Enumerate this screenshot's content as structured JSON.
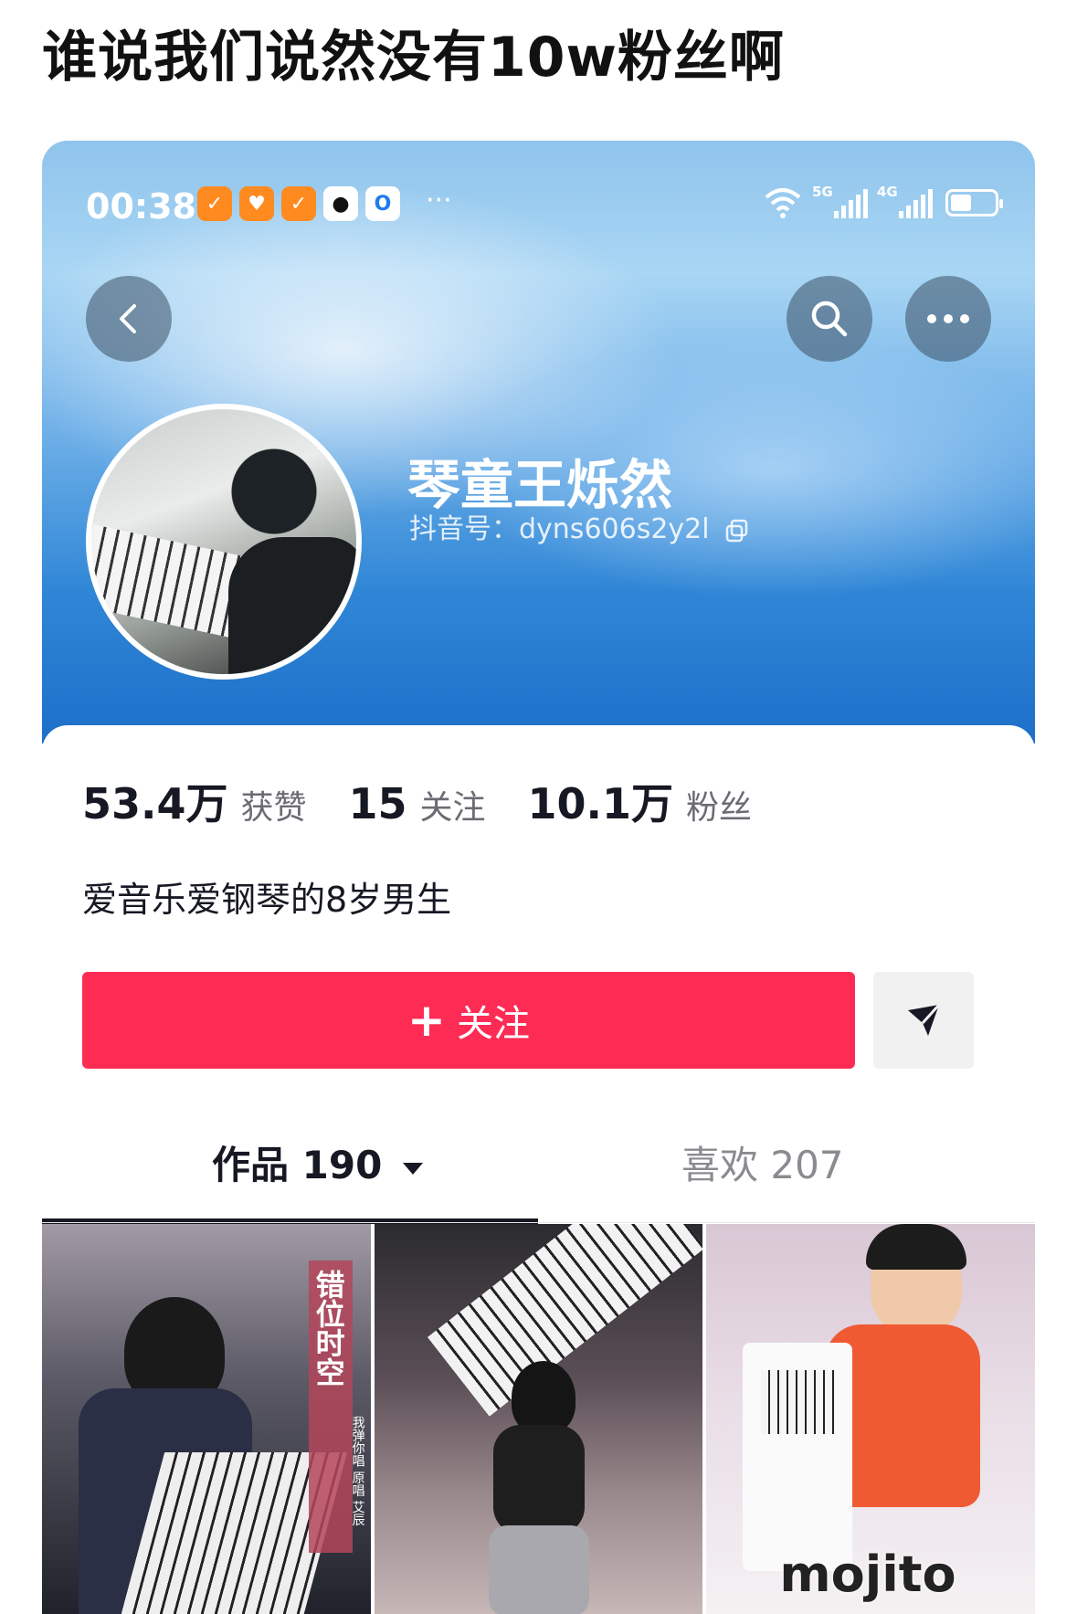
{
  "post": {
    "title": "谁说我们说然没有10w粉丝啊"
  },
  "status_bar": {
    "time": "00:38",
    "more": "···",
    "signal_5g": "5G",
    "signal_4g": "4G"
  },
  "profile": {
    "nickname": "琴童王烁然",
    "douyin_id": "抖音号：dyns606s2y2l",
    "bio": "爱音乐爱钢琴的8岁男生"
  },
  "stats": [
    {
      "value": "53.4万",
      "label": "获赞"
    },
    {
      "value": "15",
      "label": "关注"
    },
    {
      "value": "10.1万",
      "label": "粉丝"
    }
  ],
  "actions": {
    "follow_plus": "+",
    "follow_label": "关注"
  },
  "tabs": [
    {
      "label": "作品 190",
      "active": true
    },
    {
      "label": "喜欢 207",
      "active": false
    }
  ],
  "videos": [
    {
      "cover_title": "错位时空",
      "cover_sub": "我弹你唱 原唱 艾辰"
    },
    {
      "cover_title": ""
    },
    {
      "cover_title": "mojito"
    }
  ],
  "colors": {
    "accent": "#fe2c55",
    "text": "#161823",
    "muted": "#8a8b91"
  },
  "icons": [
    "back-icon",
    "search-icon",
    "more-icon",
    "copy-icon",
    "send-icon",
    "dropdown-icon",
    "wifi-icon",
    "battery-icon"
  ]
}
